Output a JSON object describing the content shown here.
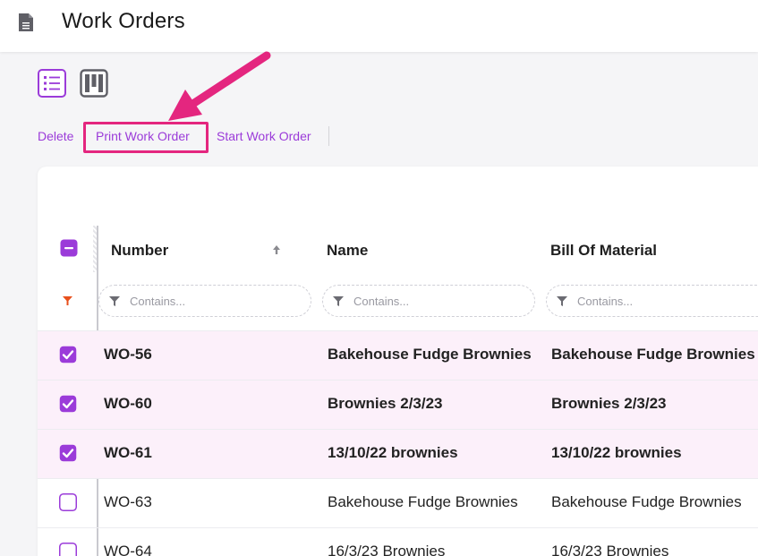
{
  "page": {
    "title": "Work Orders",
    "icon": "document-icon"
  },
  "view_toggle": [
    {
      "name": "list-view-icon",
      "active": true
    },
    {
      "name": "board-view-icon",
      "active": false
    }
  ],
  "actions": {
    "delete": "Delete",
    "print": "Print Work Order",
    "start": "Start Work Order"
  },
  "table": {
    "columns": [
      "Number",
      "Name",
      "Bill Of Material"
    ],
    "sorted_column": "Number",
    "sort_direction": "ascending",
    "filter_placeholder": "Contains...",
    "rows": [
      {
        "number": "WO-56",
        "name": "Bakehouse Fudge Brownies",
        "bom": "Bakehouse Fudge Brownies",
        "selected": true
      },
      {
        "number": "WO-60",
        "name": "Brownies 2/3/23",
        "bom": "Brownies 2/3/23",
        "selected": true
      },
      {
        "number": "WO-61",
        "name": "13/10/22 brownies",
        "bom": "13/10/22 brownies",
        "selected": true
      },
      {
        "number": "WO-63",
        "name": "Bakehouse Fudge Brownies",
        "bom": "Bakehouse Fudge Brownies",
        "selected": false
      },
      {
        "number": "WO-64",
        "name": "16/3/23 Brownies",
        "bom": "16/3/23 Brownies",
        "selected": false
      }
    ]
  },
  "colors": {
    "accent": "#9b3bd9",
    "highlight": "#e4267f",
    "selected_row": "#fcf0fa",
    "filter_active": "#e8501c"
  }
}
